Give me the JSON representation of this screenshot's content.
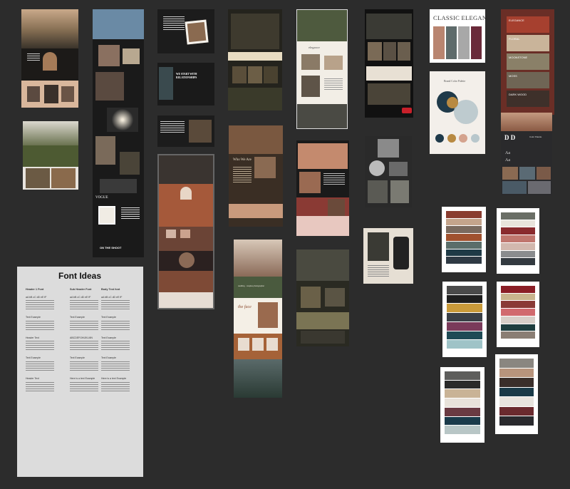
{
  "board": {
    "background": "#2c2c2c"
  },
  "font_ideas": {
    "title": "Font Ideas",
    "col1": [
      "Header 1 Font",
      "aA bB cC dD eE fF",
      "Text Example",
      "Header Text",
      "Text Example",
      "Header Text"
    ],
    "col2": [
      "Sub Header Font",
      "aA bB cC dD eE fF",
      "Text Example",
      "ABCDEFGHIJKLMN",
      "Text Example",
      "Here is a text Example"
    ],
    "col3": [
      "Body Text font",
      "aA bB cC dD eE fF",
      "Text Example",
      "Text Example",
      "Text Example",
      "Here is a text Example"
    ]
  },
  "classic_elegance": {
    "title": "CLASSIC ELEGANCE",
    "colors": [
      "#b98570",
      "#5e6b6b",
      "#a8a8a8",
      "#6a2a3a"
    ]
  },
  "earth_palette": {
    "labels": [
      "ELEGANCE",
      "FLORAL",
      "MOONSTONE",
      "MOSS",
      "DARK WOOD"
    ],
    "colors": [
      "#a6402f",
      "#c9b49a",
      "#8a8068",
      "#6f6555",
      "#3e302a"
    ]
  },
  "brand_palette": {
    "title": "Brand Color Palette",
    "colors": [
      "#1f3a4a",
      "#b88a42",
      "#d4a38e",
      "#b8c7cc"
    ]
  },
  "dd_brand": {
    "letters": "D D",
    "sample": "Aa",
    "label": "Color Palette"
  },
  "mockups": {
    "elegance_label": "elegance",
    "who_label": "Who We Are",
    "the_face": "the face",
    "start_with": "WE START WITH RELATIONSHIPS",
    "vogue": "VOGUE",
    "on_the_shoot": "ON THE SHOOT",
    "font_label": "wedding · couples photographer"
  },
  "swatch_cards": [
    {
      "colors": [
        "#8a3d30",
        "#c4a48b",
        "#7a6a5e",
        "#a0512e",
        "#5b6e6a",
        "#1f3a46",
        "#2f3a44"
      ]
    },
    {
      "colors": [
        "#6a6e66",
        "#e9e4dc",
        "#8a2a2e",
        "#c0766e",
        "#d2b8ae",
        "#8a8c8e",
        "#333a40"
      ]
    },
    {
      "colors": [
        "#4a4a4a",
        "#1e1e1e",
        "#c99a3a",
        "#3a3f46",
        "#7a3a5a",
        "#1f4a55",
        "#9fc3c7"
      ]
    },
    {
      "colors": [
        "#8a1e26",
        "#c9b48e",
        "#8a3a36",
        "#d16a6e",
        "#d8cfc8",
        "#1f3e3e",
        "#8a7e74"
      ]
    },
    {
      "colors": [
        "#5e5e5c",
        "#2a2a2a",
        "#c9b396",
        "#e8e2da",
        "#6a3a42",
        "#1a3a4a",
        "#b8c6c6"
      ]
    },
    {
      "colors": [
        "#8a8680",
        "#b8947c",
        "#3a2e2a",
        "#1a3a48",
        "#e8e4de",
        "#6a2a2e",
        "#2a2a2e"
      ]
    }
  ]
}
